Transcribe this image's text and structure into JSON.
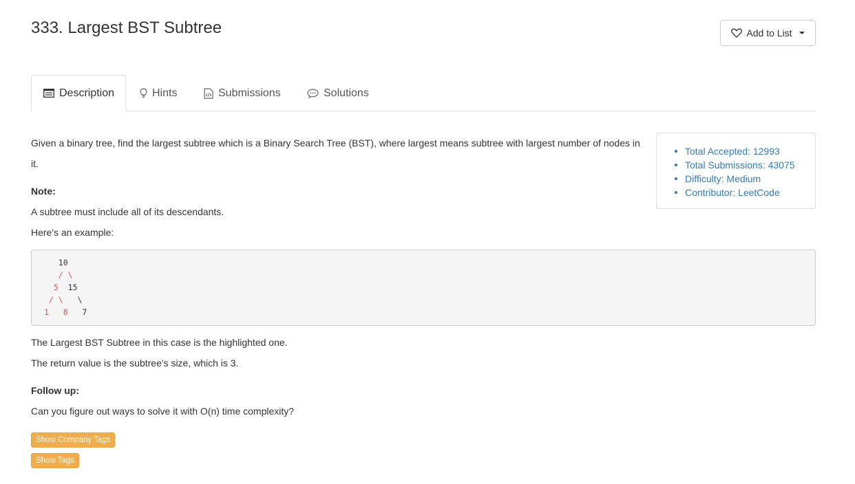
{
  "problem": {
    "title": "333. Largest BST Subtree"
  },
  "toolbar": {
    "add_to_list": "Add to List"
  },
  "tabs": [
    {
      "label": "Description",
      "icon": "list-icon",
      "active": true
    },
    {
      "label": "Hints",
      "icon": "lightbulb-icon"
    },
    {
      "label": "Submissions",
      "icon": "code-file-icon"
    },
    {
      "label": "Solutions",
      "icon": "chat-bubble-icon"
    }
  ],
  "description": {
    "intro_line1": "Given a binary tree, find the largest subtree which is a Binary Search Tree (BST), where largest means subtree with largest number of nodes in",
    "intro_line2": "it.",
    "note_label": "Note:",
    "note_text": "A subtree must include all of its descendants.",
    "example_label": "Here's an example:",
    "tree_lines": {
      "l1": "   10",
      "l2a": "   / \\",
      "l3a": "  ",
      "l3b": "5",
      "l3c": "  15",
      "l4a": " / \\",
      "l4b": "   \\",
      "l5a": "1",
      "l5b": "   8",
      "l5c": "   7"
    },
    "result_line1": "The Largest BST Subtree in this case is the highlighted one.",
    "result_line2": "The return value is the subtree's size, which is 3.",
    "followup_label": "Follow up:",
    "followup_text": "Can you figure out ways to solve it with O(n) time complexity?"
  },
  "stats": {
    "accepted": "Total Accepted: 12993",
    "submissions": "Total Submissions: 43075",
    "difficulty": "Difficulty: Medium",
    "contributor": "Contributor: LeetCode"
  },
  "buttons": {
    "company_tags": "Show Company Tags",
    "tags": "Show Tags"
  },
  "colors": {
    "link": "#337ab7",
    "tag_button": "#f0ad4e",
    "highlight": "#d9534f"
  }
}
